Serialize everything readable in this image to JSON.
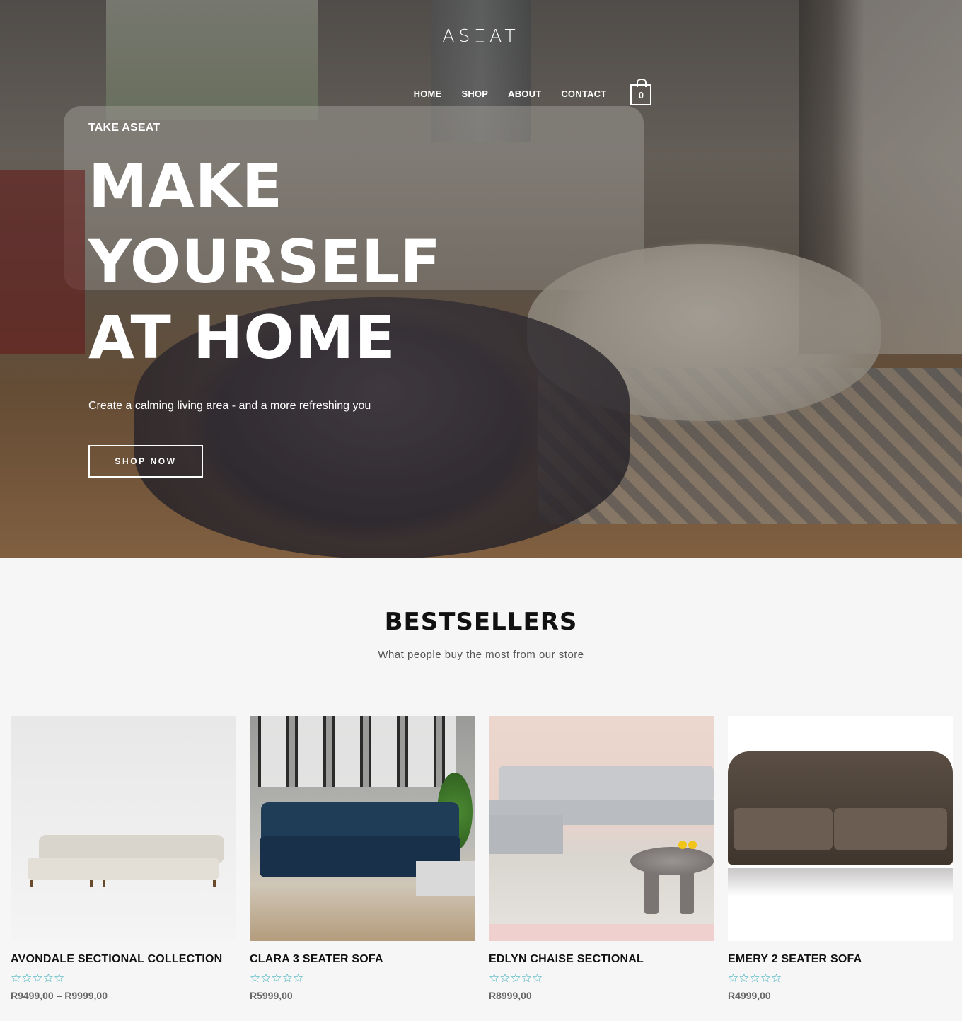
{
  "brand": {
    "logo_text": "ASΞAT"
  },
  "nav": {
    "items": [
      "HOME",
      "SHOP",
      "ABOUT",
      "CONTACT"
    ],
    "cart_count": "0"
  },
  "hero": {
    "eyebrow": "TAKE ASEAT",
    "headline": "MAKE YOURSELF AT HOME",
    "subline": "Create a calming living area - and a more refreshing you",
    "cta_label": "SHOP NOW"
  },
  "bestsellers": {
    "title": "BESTSELLERS",
    "subtitle": "What people buy the most from our store",
    "products": [
      {
        "name": "AVONDALE SECTIONAL COLLECTION",
        "rating_stars": "☆☆☆☆☆",
        "rating_value": 0,
        "price": "R9499,00 – R9999,00"
      },
      {
        "name": "CLARA 3 SEATER SOFA",
        "rating_stars": "☆☆☆☆☆",
        "rating_value": 0,
        "price": "R5999,00"
      },
      {
        "name": "EDLYN CHAISE SECTIONAL",
        "rating_stars": "☆☆☆☆☆",
        "rating_value": 0,
        "price": "R8999,00"
      },
      {
        "name": "EMERY 2 SEATER SOFA",
        "rating_stars": "☆☆☆☆☆",
        "rating_value": 0,
        "price": "R4999,00"
      }
    ]
  },
  "colors": {
    "accent_star": "#2aa8b4",
    "background": "#f6f6f6",
    "hero_text": "#ffffff"
  },
  "icons": {
    "cart": "shopping-bag-icon",
    "rating": "star-outline-icon"
  }
}
